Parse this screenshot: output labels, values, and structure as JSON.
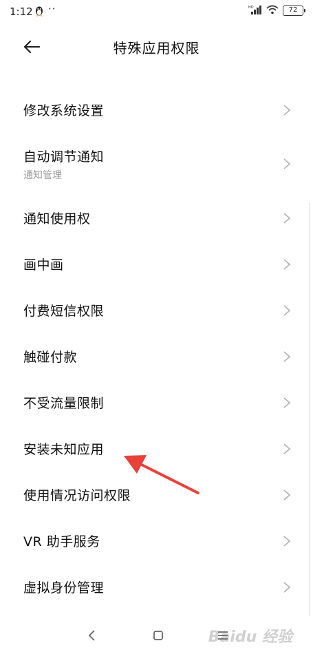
{
  "status": {
    "time": "1:12",
    "dots": "··",
    "battery": "72"
  },
  "header": {
    "title": "特殊应用权限"
  },
  "list": [
    {
      "title": "修改系统设置",
      "subtitle": ""
    },
    {
      "title": "自动调节通知",
      "subtitle": "通知管理"
    },
    {
      "title": "通知使用权",
      "subtitle": ""
    },
    {
      "title": "画中画",
      "subtitle": ""
    },
    {
      "title": "付费短信权限",
      "subtitle": ""
    },
    {
      "title": "触碰付款",
      "subtitle": ""
    },
    {
      "title": "不受流量限制",
      "subtitle": ""
    },
    {
      "title": "安装未知应用",
      "subtitle": ""
    },
    {
      "title": "使用情况访问权限",
      "subtitle": ""
    },
    {
      "title": "VR 助手服务",
      "subtitle": ""
    },
    {
      "title": "虚拟身份管理",
      "subtitle": ""
    }
  ],
  "watermark": "Baidu 经验",
  "colors": {
    "accent_arrow": "#e8413a",
    "chevron": "#b5b5b5",
    "subtitle": "#9a9a9a"
  },
  "icons": {
    "back": "arrow-left-icon",
    "chevron": "chevron-right-icon",
    "wifi": "wifi-icon",
    "signal": "signal-icon",
    "battery": "battery-icon"
  }
}
